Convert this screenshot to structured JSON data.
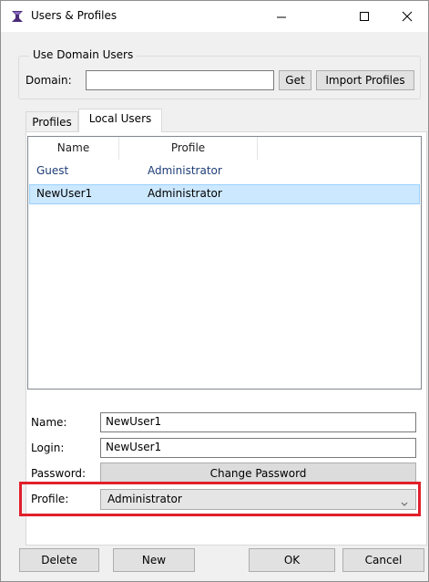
{
  "window": {
    "title": "Users & Profiles"
  },
  "titlebar": {
    "minimize_icon": "minimize-icon",
    "maximize_icon": "maximize-icon",
    "close_icon": "close-icon"
  },
  "domain_group": {
    "legend": "Use Domain Users",
    "domain_label": "Domain:",
    "domain_value": "",
    "get_button": "Get",
    "import_button": "Import Profiles"
  },
  "tabs": [
    {
      "label": "Profiles",
      "active": false
    },
    {
      "label": "Local Users",
      "active": true
    }
  ],
  "users_table": {
    "columns": [
      "Name",
      "Profile"
    ],
    "rows": [
      {
        "name": "Guest",
        "profile": "Administrator",
        "selected": false
      },
      {
        "name": "NewUser1",
        "profile": "Administrator",
        "selected": true
      }
    ]
  },
  "details": {
    "name_label": "Name:",
    "name_value": "NewUser1",
    "login_label": "Login:",
    "login_value": "NewUser1",
    "password_label": "Password:",
    "change_password_button": "Change Password",
    "profile_label": "Profile:",
    "profile_value": "Administrator"
  },
  "buttons": {
    "delete": "Delete",
    "new": "New",
    "ok": "OK",
    "cancel": "Cancel"
  },
  "colors": {
    "highlight": "#e0202b",
    "selection": "#cce8ff",
    "app_icon": "#4b2c7a"
  }
}
